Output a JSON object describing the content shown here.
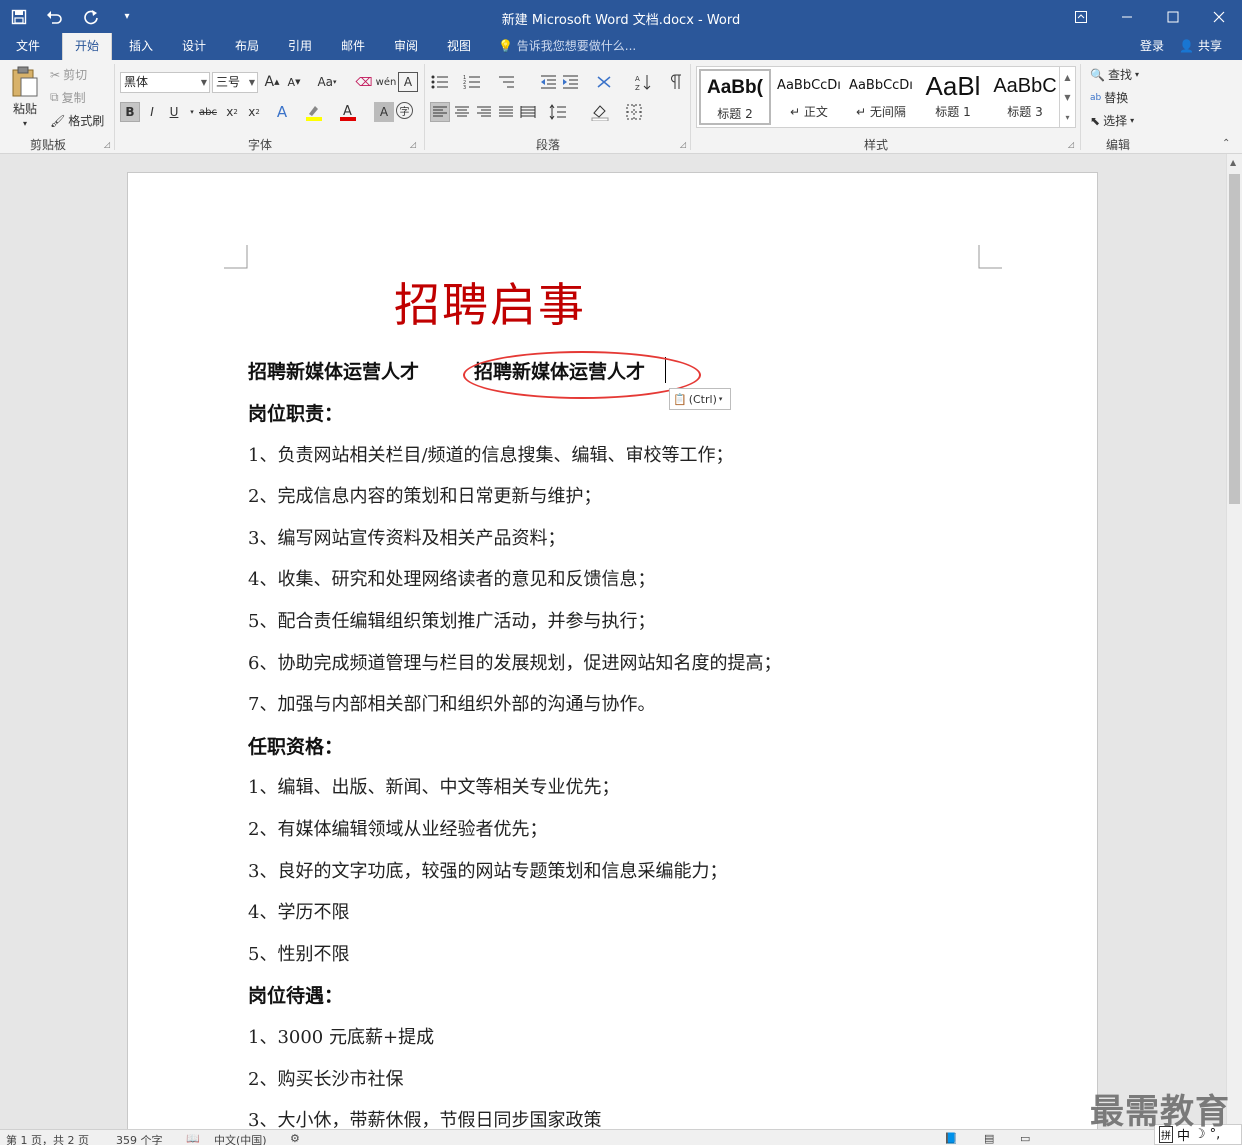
{
  "titlebar": {
    "title": "新建 Microsoft Word 文档.docx - Word",
    "qat_icons": [
      "save-icon",
      "undo-icon",
      "redo-icon",
      "customize-qat-icon"
    ]
  },
  "tabs": [
    {
      "label": "文件",
      "active": false
    },
    {
      "label": "开始",
      "active": true
    },
    {
      "label": "插入",
      "active": false
    },
    {
      "label": "设计",
      "active": false
    },
    {
      "label": "布局",
      "active": false
    },
    {
      "label": "引用",
      "active": false
    },
    {
      "label": "邮件",
      "active": false
    },
    {
      "label": "审阅",
      "active": false
    },
    {
      "label": "视图",
      "active": false
    }
  ],
  "tellme": "告诉我您想要做什么...",
  "account": {
    "login": "登录",
    "share": "共享"
  },
  "ribbon": {
    "clipboard": {
      "label": "剪贴板",
      "paste": "粘贴",
      "cut": "剪切",
      "copy": "复制",
      "format_painter": "格式刷"
    },
    "font": {
      "label": "字体",
      "font_name": "黑体",
      "font_size": "三号",
      "change_case": "Aa"
    },
    "paragraph": {
      "label": "段落"
    },
    "styles": {
      "label": "样式",
      "items": [
        {
          "preview": "AaBb(",
          "name": "标题 2",
          "selected": true
        },
        {
          "preview": "AaBbCcDı",
          "name": "正文",
          "selected": false
        },
        {
          "preview": "AaBbCcDı",
          "name": "无间隔",
          "selected": false
        },
        {
          "preview": "AaBl",
          "name": "标题 1",
          "selected": false
        },
        {
          "preview": "AaBbC",
          "name": "标题 3",
          "selected": false
        }
      ]
    },
    "editing": {
      "label": "编辑",
      "find": "查找",
      "replace": "替换",
      "select": "选择"
    }
  },
  "document": {
    "title": "招聘启事",
    "heading_line": "招聘新媒体运营人才",
    "pasted_text": "招聘新媒体运营人才",
    "paste_options": "(Ctrl)",
    "lines": [
      {
        "text": "岗位职责：",
        "bold": true
      },
      {
        "text": "1、负责网站相关栏目/频道的信息搜集、编辑、审校等工作；",
        "bold": false
      },
      {
        "text": "2、完成信息内容的策划和日常更新与维护；",
        "bold": false
      },
      {
        "text": "3、编写网站宣传资料及相关产品资料；",
        "bold": false
      },
      {
        "text": "4、收集、研究和处理网络读者的意见和反馈信息；",
        "bold": false
      },
      {
        "text": "5、配合责任编辑组织策划推广活动，并参与执行；",
        "bold": false
      },
      {
        "text": "6、协助完成频道管理与栏目的发展规划，促进网站知名度的提高；",
        "bold": false
      },
      {
        "text": "7、加强与内部相关部门和组织外部的沟通与协作。",
        "bold": false
      },
      {
        "text": "任职资格：",
        "bold": true
      },
      {
        "text": "1、编辑、出版、新闻、中文等相关专业优先；",
        "bold": false
      },
      {
        "text": "2、有媒体编辑领域从业经验者优先；",
        "bold": false
      },
      {
        "text": "3、良好的文字功底，较强的网站专题策划和信息采编能力；",
        "bold": false
      },
      {
        "text": "4、学历不限",
        "bold": false
      },
      {
        "text": "5、性别不限",
        "bold": false
      },
      {
        "text": "岗位待遇：",
        "bold": true
      },
      {
        "text": "1、3000 元底薪+提成",
        "bold": false
      },
      {
        "text": "2、购买长沙市社保",
        "bold": false
      },
      {
        "text": "3、大小休，带薪休假，节假日同步国家政策",
        "bold": false
      }
    ]
  },
  "statusbar": {
    "page": "第 1 页，共 2 页",
    "words": "359 个字",
    "language": "中文(中国)"
  },
  "ime": {
    "mode1": "拼",
    "mode2": "中"
  },
  "watermark": "最需教育",
  "colors": {
    "brand": "#2b579a",
    "title_red": "#c00000",
    "circle_red": "#e53935"
  }
}
